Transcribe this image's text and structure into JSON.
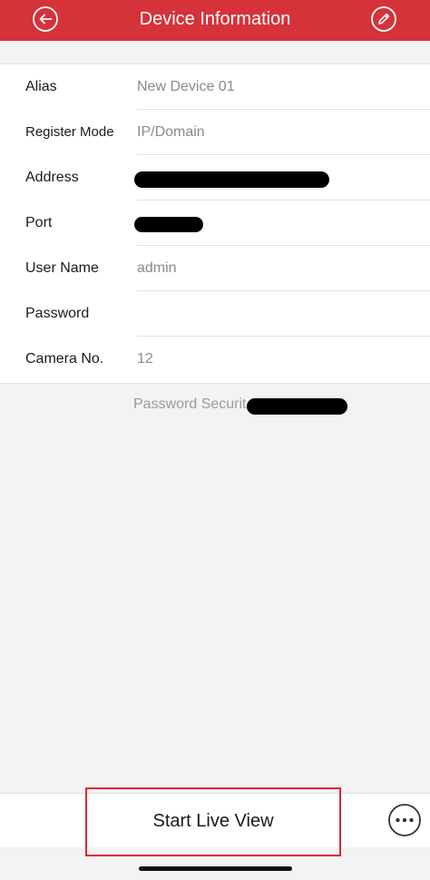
{
  "header": {
    "title": "Device Information",
    "back_icon": "arrow-left-circle-icon",
    "edit_icon": "pencil-circle-icon",
    "background_color": "#d6323a"
  },
  "fields": [
    {
      "label": "Alias",
      "value": "New Device 01"
    },
    {
      "label": "Register Mode",
      "value": "IP/Domain"
    },
    {
      "label": "Address",
      "value": ""
    },
    {
      "label": "Port",
      "value": ""
    },
    {
      "label": "User Name",
      "value": "admin"
    },
    {
      "label": "Password",
      "value": ""
    },
    {
      "label": "Camera No.",
      "value": "12"
    }
  ],
  "security_note": "Password Securit",
  "bottom_bar": {
    "start_live_view_label": "Start Live View",
    "more_icon": "more-horizontal-circle-icon",
    "highlight_color": "#e1262f"
  }
}
